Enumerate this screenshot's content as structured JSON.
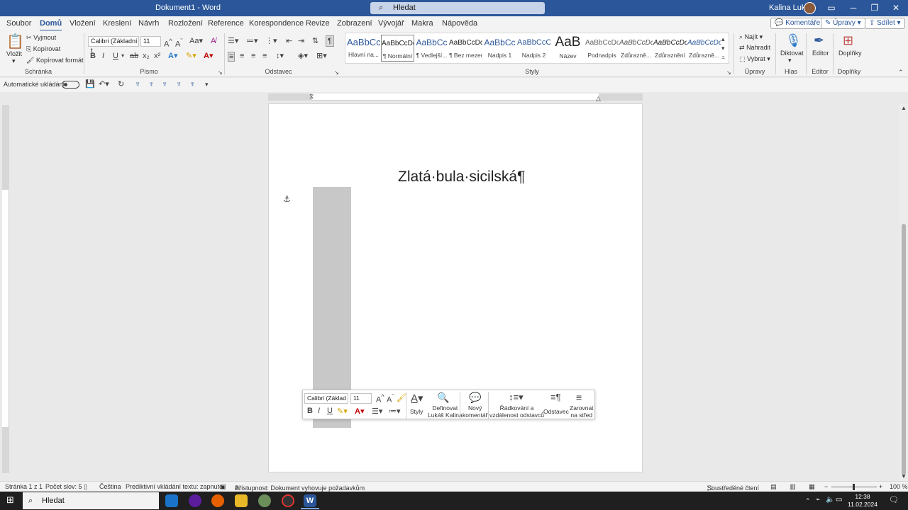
{
  "window": {
    "title": "Dokument1  -  Word",
    "search_placeholder": "Hledat",
    "user": "Kalina Lukáš"
  },
  "tabs": [
    "Soubor",
    "Domů",
    "Vložení",
    "Kreslení",
    "Návrh",
    "Rozložení",
    "Reference",
    "Korespondence",
    "Revize",
    "Zobrazení",
    "Vývojář",
    "Makra",
    "Nápověda"
  ],
  "top_buttons": {
    "comments": "Komentáře",
    "edit": "Úpravy",
    "share": "Sdílet"
  },
  "clipboard": {
    "paste": "Vložit",
    "cut": "Vyjmout",
    "copy": "Kopírovat",
    "format_painter": "Kopírovat formát",
    "label": "Schránka"
  },
  "font": {
    "name": "Calibri (Základní t",
    "size": "11",
    "label": "Písmo"
  },
  "paragraph": {
    "label": "Odstavec"
  },
  "styles": {
    "label": "Styly",
    "items": [
      {
        "preview": "AaBbCc",
        "name": "Hlavní na..."
      },
      {
        "preview": "AaBbCcDc",
        "name": "¶ Normální"
      },
      {
        "preview": "AaBbCc",
        "name": "¶ Vedlejší..."
      },
      {
        "preview": "AaBbCcDc",
        "name": "¶ Bez mezer"
      },
      {
        "preview": "AaBbCc",
        "name": "Nadpis 1"
      },
      {
        "preview": "AaBbCcC",
        "name": "Nadpis 2"
      },
      {
        "preview": "AaB",
        "name": "Název"
      },
      {
        "preview": "AaBbCcDc",
        "name": "Podnadpis"
      },
      {
        "preview": "AaBbCcDc",
        "name": "Zdůrazně..."
      },
      {
        "preview": "AaBbCcDc",
        "name": "Zdůraznění"
      },
      {
        "preview": "AaBbCcDc",
        "name": "Zdůrazně..."
      }
    ]
  },
  "editing": {
    "find": "Najít",
    "replace": "Nahradit",
    "select": "Vybrat",
    "label": "Úpravy"
  },
  "voice": {
    "dictate": "Diktovat",
    "label": "Hlas"
  },
  "editor": {
    "name": "Editor",
    "label": "Editor"
  },
  "addins": {
    "name": "Doplňky",
    "label": "Doplňky"
  },
  "qat": {
    "autosave": "Automatické ukládání"
  },
  "document": {
    "title_text": "Zlatá·bula·sicilská¶"
  },
  "mini_toolbar": {
    "font": "Calibri (Základ",
    "size": "11",
    "styles": "Styly",
    "define_1": "Definovat",
    "define_2": "Lukáš Kalina",
    "comment_1": "Nový",
    "comment_2": "komentář",
    "spacing_1": "Řádkování a",
    "spacing_2": "vzdálenost odstavců",
    "paragraph": "Odstavec",
    "center_1": "Zarovnat",
    "center_2": "na střed"
  },
  "status": {
    "page": "Stránka 1 z 1",
    "words": "Počet slov: 5",
    "lang": "Čeština",
    "predictive": "Prediktivní vkládání textu: zapnuto",
    "accessibility": "Přístupnost: Dokument vyhovuje požadavkům",
    "focus": "Soustředěné čtení",
    "zoom": "100 %"
  },
  "taskbar": {
    "search": "Hledat",
    "time": "12:38",
    "date": "11.02.2024"
  },
  "colors": {
    "accent": "#2b579a"
  }
}
